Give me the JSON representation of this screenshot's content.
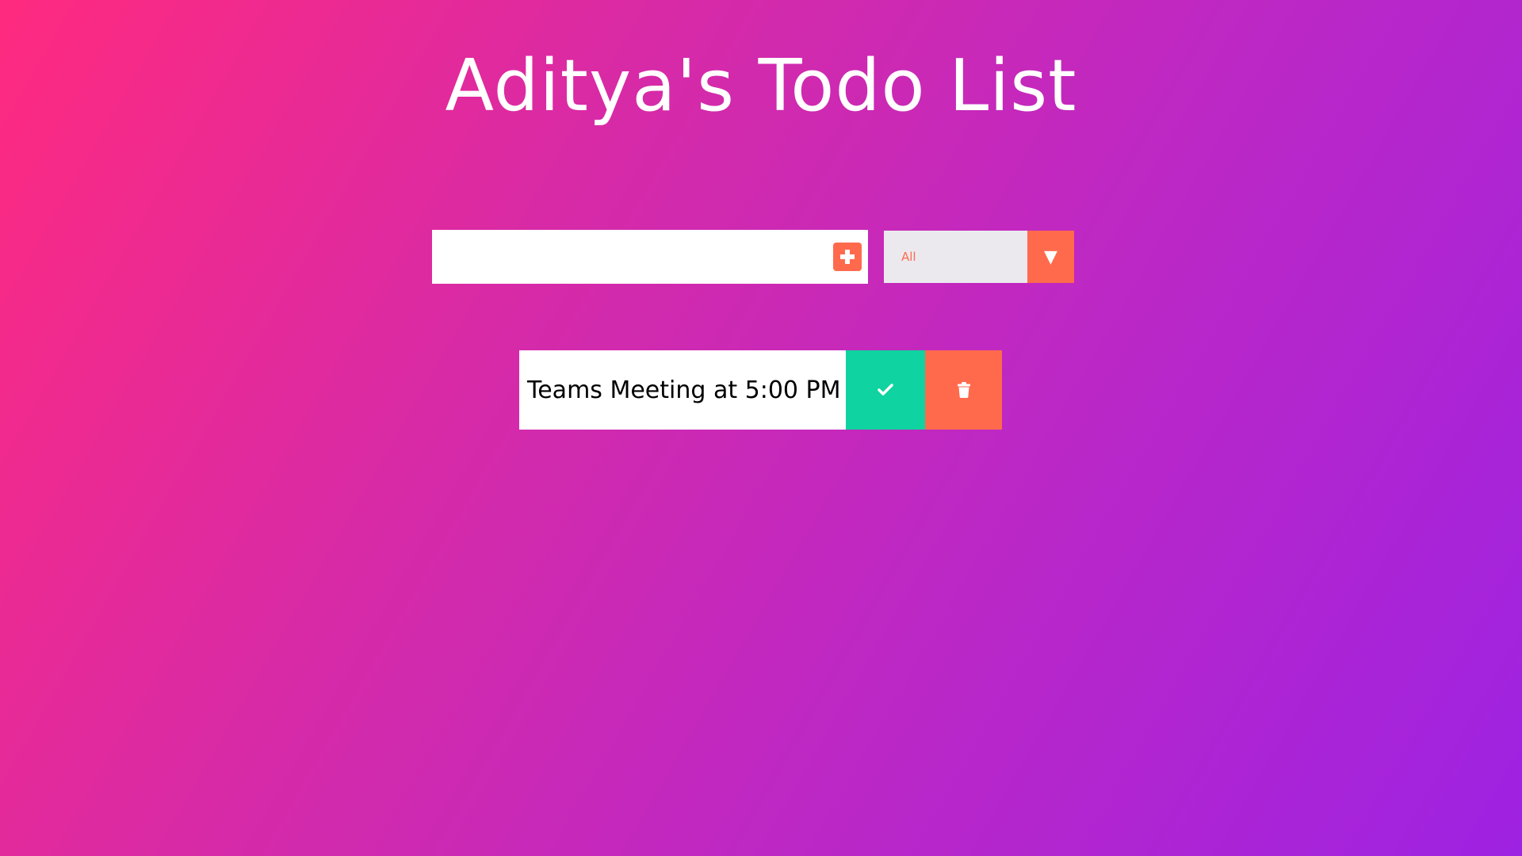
{
  "header": {
    "title": "Aditya's Todo List"
  },
  "form": {
    "input_value": "",
    "input_placeholder": "",
    "add_icon": "plus-square-icon",
    "filter": {
      "selected": "All",
      "arrow_glyph": "▼"
    }
  },
  "todos": [
    {
      "text": "Teams Meeting at 5:00 PM",
      "complete_icon": "check-icon",
      "delete_icon": "trash-icon"
    }
  ],
  "colors": {
    "accent": "#ff6a4d",
    "complete": "#0fd3a0",
    "gradient_start": "#ff2a7f",
    "gradient_end": "#9e22e2",
    "select_bg": "#ebe9ee"
  }
}
